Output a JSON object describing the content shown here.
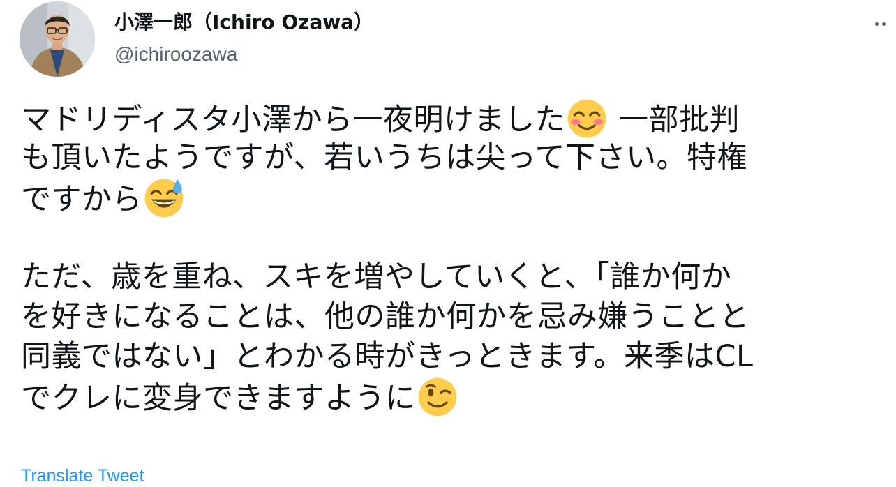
{
  "author": {
    "display_name": "小澤一郎（Ichiro Ozawa）",
    "handle": "@ichiroozawa",
    "avatar_icon": "profile-photo"
  },
  "more_menu_icon": "more-horizontal-icon",
  "tweet": {
    "lines": [
      {
        "text_a": "マドリディスタ小澤から一夜明けました",
        "emoji": "smiling-face-with-smiling-eyes",
        "text_b": " 一部批判"
      },
      {
        "text_a": "も頂いたようですが、若いうちは尖って下さい。特権",
        "emoji": null,
        "text_b": ""
      },
      {
        "text_a": "ですから",
        "emoji": "grinning-face-with-sweat",
        "text_b": ""
      },
      {
        "text_a": "ただ、歳を重ね、スキを増やしていくと、「誰か何か",
        "emoji": null,
        "text_b": ""
      },
      {
        "text_a": "を好きになることは、他の誰か何かを忌み嫌うことと",
        "emoji": null,
        "text_b": ""
      },
      {
        "text_a": "同義ではない」とわかる時がきっときます。来季はCL",
        "emoji": null,
        "text_b": ""
      },
      {
        "text_a": "でクレに変身できますように",
        "emoji": "winking-face",
        "text_b": ""
      }
    ]
  },
  "translate_label": "Translate Tweet",
  "colors": {
    "text": "#0f1419",
    "secondary": "#536471",
    "link": "#1d9bf0",
    "emoji_yellow": "#ffcc4d"
  }
}
